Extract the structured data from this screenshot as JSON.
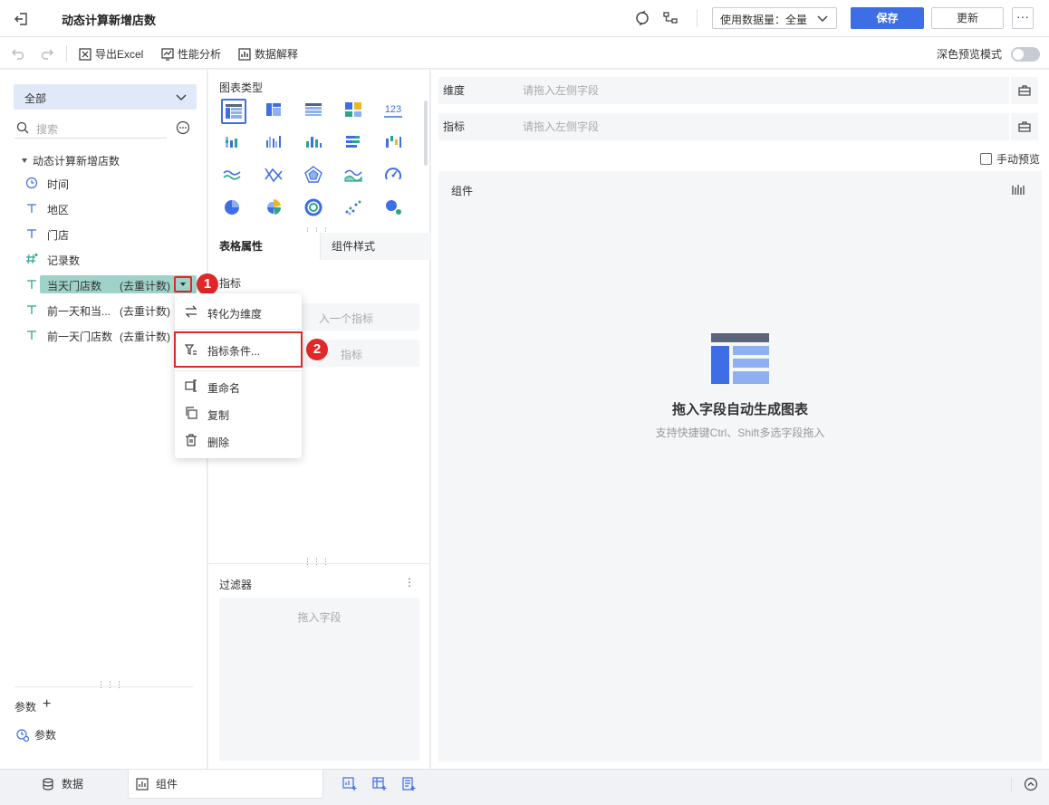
{
  "header": {
    "title": "动态计算新增店数",
    "data_volume_label": "使用数据量：全量",
    "save_label": "保存",
    "update_label": "更新",
    "more_label": "···"
  },
  "toolbar": {
    "export_label": "导出Excel",
    "perf_label": "性能分析",
    "explain_label": "数据解释",
    "dark_mode_label": "深色预览模式"
  },
  "left": {
    "dataset_select": "全部",
    "search_placeholder": "搜索",
    "tree_root": "动态计算新增店数",
    "fields": [
      {
        "icon": "clock-icon",
        "name": "时间",
        "agg": ""
      },
      {
        "icon": "text-type-icon",
        "name": "地区",
        "agg": ""
      },
      {
        "icon": "text-type-icon",
        "name": "门店",
        "agg": ""
      },
      {
        "icon": "number-type-icon",
        "name": "记录数",
        "agg": ""
      },
      {
        "icon": "text-type-icon",
        "name": "当天门店数",
        "agg": "(去重计数)"
      },
      {
        "icon": "text-type-icon",
        "name": "前一天和当...",
        "agg": "(去重计数)"
      },
      {
        "icon": "text-type-icon",
        "name": "前一天门店数",
        "agg": "(去重计数)"
      }
    ],
    "param_header": "参数",
    "param_item": "参数"
  },
  "badges": {
    "one": "1",
    "two": "2"
  },
  "menu": {
    "items": [
      {
        "icon": "swap-icon",
        "label": "转化为维度"
      },
      {
        "icon": "filter-icon",
        "label": "指标条件..."
      },
      {
        "icon": "rename-icon",
        "label": "重命名"
      },
      {
        "icon": "copy-icon",
        "label": "复制"
      },
      {
        "icon": "delete-icon",
        "label": "删除"
      }
    ]
  },
  "middle": {
    "chart_type_title": "图表类型",
    "tabs": [
      "表格属性",
      "组件样式"
    ],
    "subtitle": "指标",
    "slot1_placeholder": "入一个指标",
    "slot2_placeholder": "指标",
    "filter_title": "过滤器",
    "filter_placeholder": "拖入字段"
  },
  "right": {
    "dimension_label": "维度",
    "dimension_placeholder": "请拖入左侧字段",
    "measure_label": "指标",
    "measure_placeholder": "请拖入左侧字段",
    "manual_preview": "手动预览",
    "component_title": "组件",
    "empty_title": "拖入字段自动生成图表",
    "empty_sub": "支持快捷键Ctrl、Shift多选字段拖入"
  },
  "bottom": {
    "data_tab": "数据",
    "component_tab": "组件"
  },
  "colors": {
    "accent": "#3e6ee5",
    "highlight": "#9fd2c8",
    "annotation": "#e02828"
  }
}
